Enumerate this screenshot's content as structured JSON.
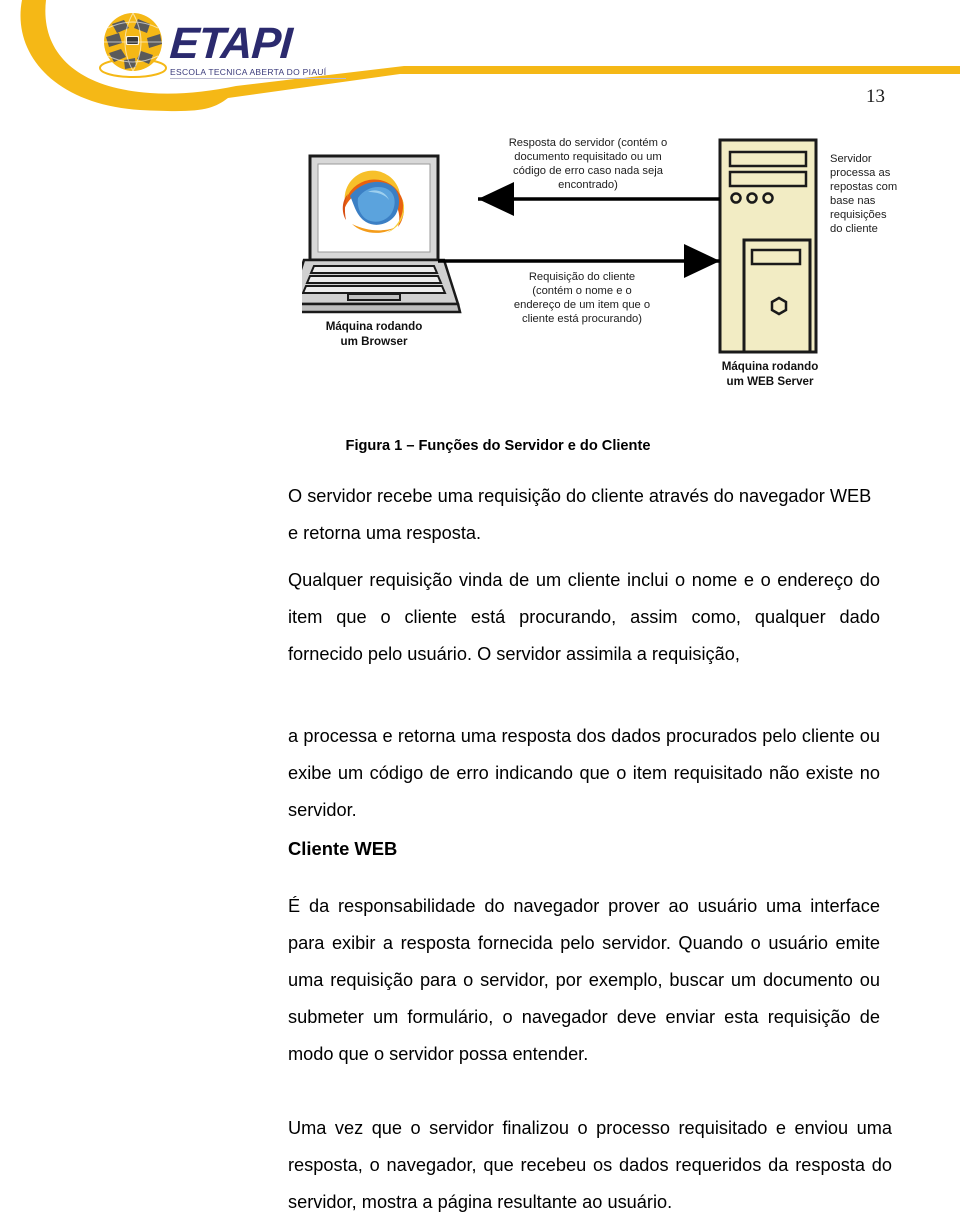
{
  "header": {
    "logo_title": "ETAPI",
    "logo_subtitle": "ESCOLA TECNICA ABERTA DO PIAUÍ",
    "logo_icon": "globe-grid-logo",
    "page_number": "13",
    "accent_color": "#F5B816",
    "logo_text_color": "#2B2A6E"
  },
  "figure": {
    "caption": "Figura 1 – Funções do Servidor e do Cliente",
    "response_arrow_label": "Resposta do servidor (contém o documento requisitado ou um código de erro caso nada seja encontrado)",
    "response_line_1": "Resposta do servidor (contém o",
    "response_line_2": "documento requisitado ou um",
    "response_line_3": "código de erro caso nada seja",
    "response_line_4": "encontrado)",
    "request_arrow_label": "Requisição do cliente (contém o nome e o endereço de um item que o cliente está procurando)",
    "request_line_1": "Requisição do cliente",
    "request_line_2": "(contém o nome e o",
    "request_line_3": "endereço de um item que o",
    "request_line_4": "cliente está procurando)",
    "server_note_line_1": "Servidor",
    "server_note_line_2": "processa as",
    "server_note_line_3": "repostas com",
    "server_note_line_4": "base nas",
    "server_note_line_5": "requisições",
    "server_note_line_6": "do cliente",
    "client_label_line_1": "Máquina rodando",
    "client_label_line_2": "um Browser",
    "server_label_line_1": "Máquina rodando",
    "server_label_line_2": "um WEB Server",
    "client_icon": "laptop-with-firefox-browser-icon",
    "server_icon": "server-tower-icon",
    "server_color": "#F2ECC4",
    "laptop_color": "#C9C9C9"
  },
  "body": {
    "paragraph_1": "O servidor recebe uma requisição do cliente através do navegador WEB e retorna uma resposta.",
    "paragraph_2": "Qualquer requisição vinda de um cliente inclui o nome e o endereço do item que o cliente está procurando, assim como, qualquer dado fornecido pelo usuário. O servidor assimila a requisição,",
    "paragraph_3": "a processa e retorna uma resposta dos dados procurados pelo cliente ou exibe um código de erro indicando que o item requisitado não existe no servidor.",
    "subheading_1": "Cliente WEB",
    "paragraph_4": "É da responsabilidade do navegador prover ao usuário uma interface para exibir a resposta fornecida pelo servidor. Quando o usuário emite uma requisição para o servidor, por exemplo, buscar um documento ou submeter um formulário, o navegador deve enviar esta requisição de modo que o servidor possa entender.",
    "paragraph_5": "Uma vez que o servidor finalizou o processo requisitado e enviou uma resposta, o navegador, que recebeu os dados requeridos da resposta do servidor, mostra a página resultante ao usuário."
  }
}
